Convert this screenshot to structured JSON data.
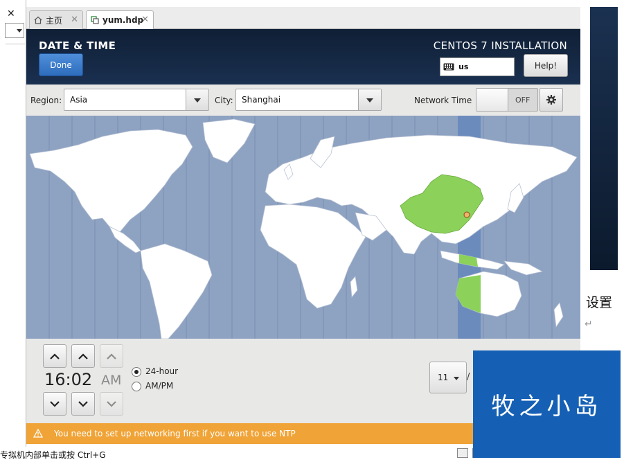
{
  "host": {
    "close_glyph": "✕"
  },
  "tabs": [
    {
      "label": "主页",
      "icon": "home-icon",
      "close": "✕"
    },
    {
      "label": "yum.hdp",
      "icon": "vm-icon",
      "close": "✕"
    }
  ],
  "header": {
    "spoke_title": "DATE & TIME",
    "done_label": "Done",
    "install_title": "CENTOS 7 INSTALLATION",
    "keyboard_layout": "us",
    "help_label": "Help!"
  },
  "controls": {
    "region_label": "Region:",
    "region_value": "Asia",
    "city_label": "City:",
    "city_value": "Shanghai",
    "network_time_label": "Network Time",
    "network_time_state": "OFF"
  },
  "time": {
    "value": "16:02",
    "ampm": "AM",
    "format_24": "24-hour",
    "format_ampm": "AM/PM",
    "selected_format": "24-hour"
  },
  "date": {
    "day": "11",
    "separator": "/"
  },
  "warning": {
    "text": "You need to set up networking first if you want to use NTP"
  },
  "status_bar": {
    "text": "专拟机内部单击或按 Ctrl+G"
  },
  "side": {
    "label": "设置",
    "return_glyph": "↵"
  },
  "watermark": {
    "text": "牧之小岛"
  },
  "colors": {
    "header_bg": "#132640",
    "map_ocean": "#8ea2c2",
    "selected_timezone_band": "#6c8bbd",
    "selected_country": "#8bd15a",
    "done_button": "#3a7bcc",
    "warning_bar": "#f0a336",
    "watermark_bg": "#1560b4"
  }
}
